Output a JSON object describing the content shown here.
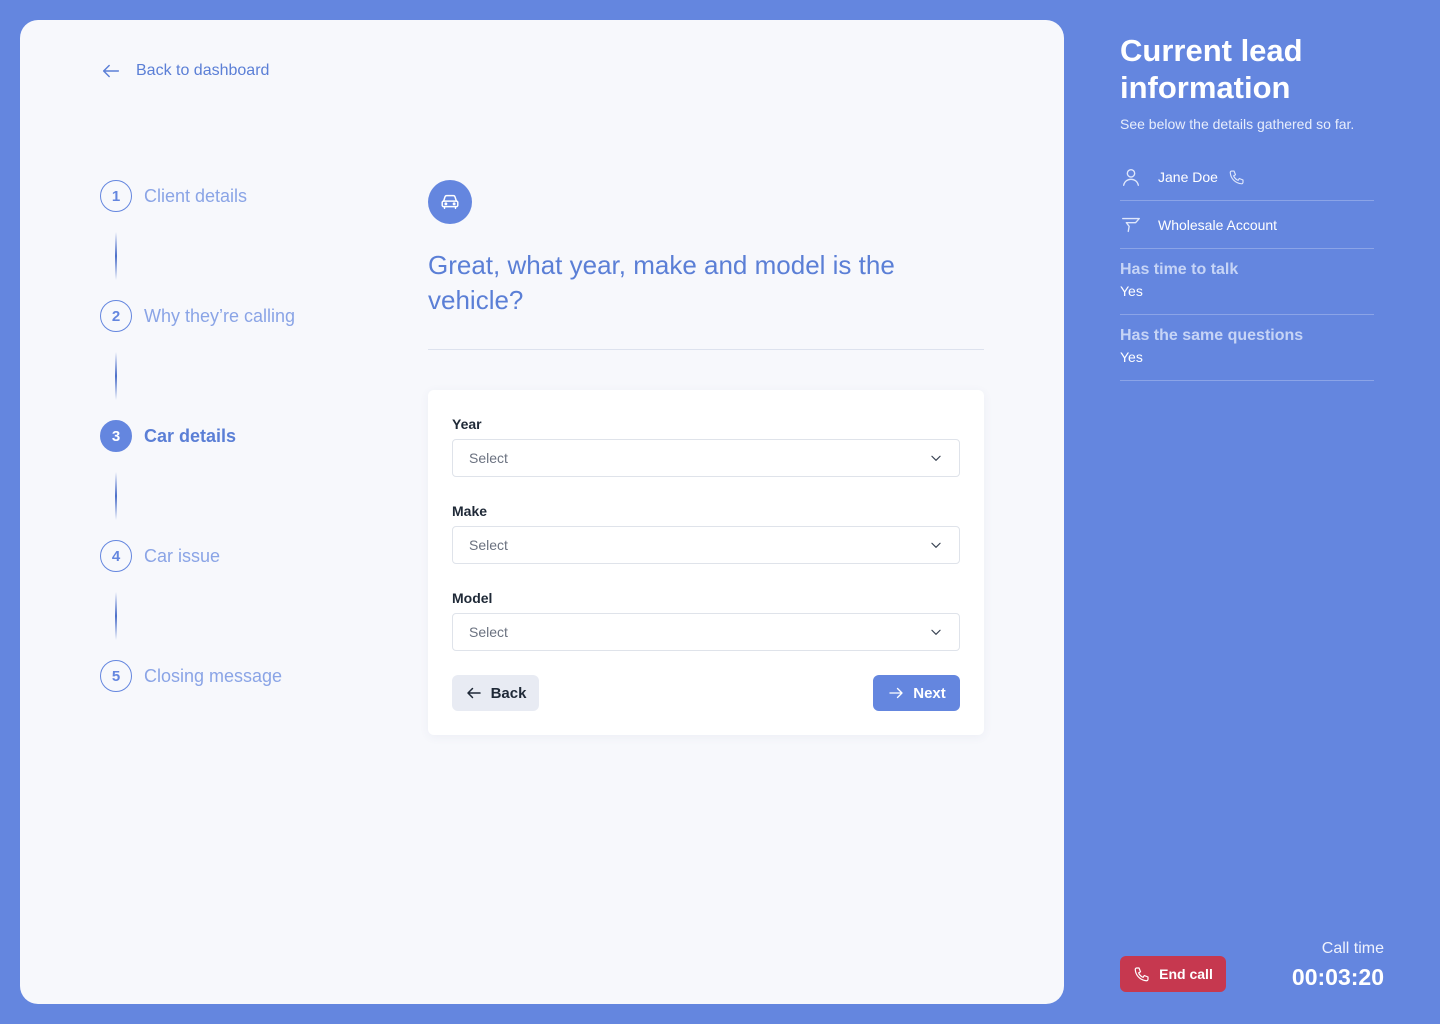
{
  "nav": {
    "back_label": "Back to dashboard"
  },
  "steps": [
    {
      "number": "1",
      "label": "Client details",
      "active": false
    },
    {
      "number": "2",
      "label": "Why they’re calling",
      "active": false
    },
    {
      "number": "3",
      "label": "Car details",
      "active": true
    },
    {
      "number": "4",
      "label": "Car issue",
      "active": false
    },
    {
      "number": "5",
      "label": "Closing message",
      "active": false
    }
  ],
  "question": {
    "icon": "car-icon",
    "text": "Great, what year, make and model is the vehicle?"
  },
  "form": {
    "year": {
      "label": "Year",
      "value": "Select"
    },
    "make": {
      "label": "Make",
      "value": "Select"
    },
    "model": {
      "label": "Model",
      "value": "Select"
    },
    "back_label": "Back",
    "next_label": "Next"
  },
  "lead": {
    "title": "Current lead information",
    "subtitle": "See below the details gathered so far.",
    "name": "Jane Doe",
    "account": "Wholesale Account",
    "fields": [
      {
        "label": "Has time to talk",
        "value": "Yes"
      },
      {
        "label": "Has the same questions",
        "value": "Yes"
      }
    ]
  },
  "call": {
    "end_label": "End call",
    "time_label": "Call time",
    "time": "00:03:20"
  },
  "colors": {
    "accent": "#6486df",
    "danger": "#c6384f",
    "background": "#f7f8fc"
  }
}
